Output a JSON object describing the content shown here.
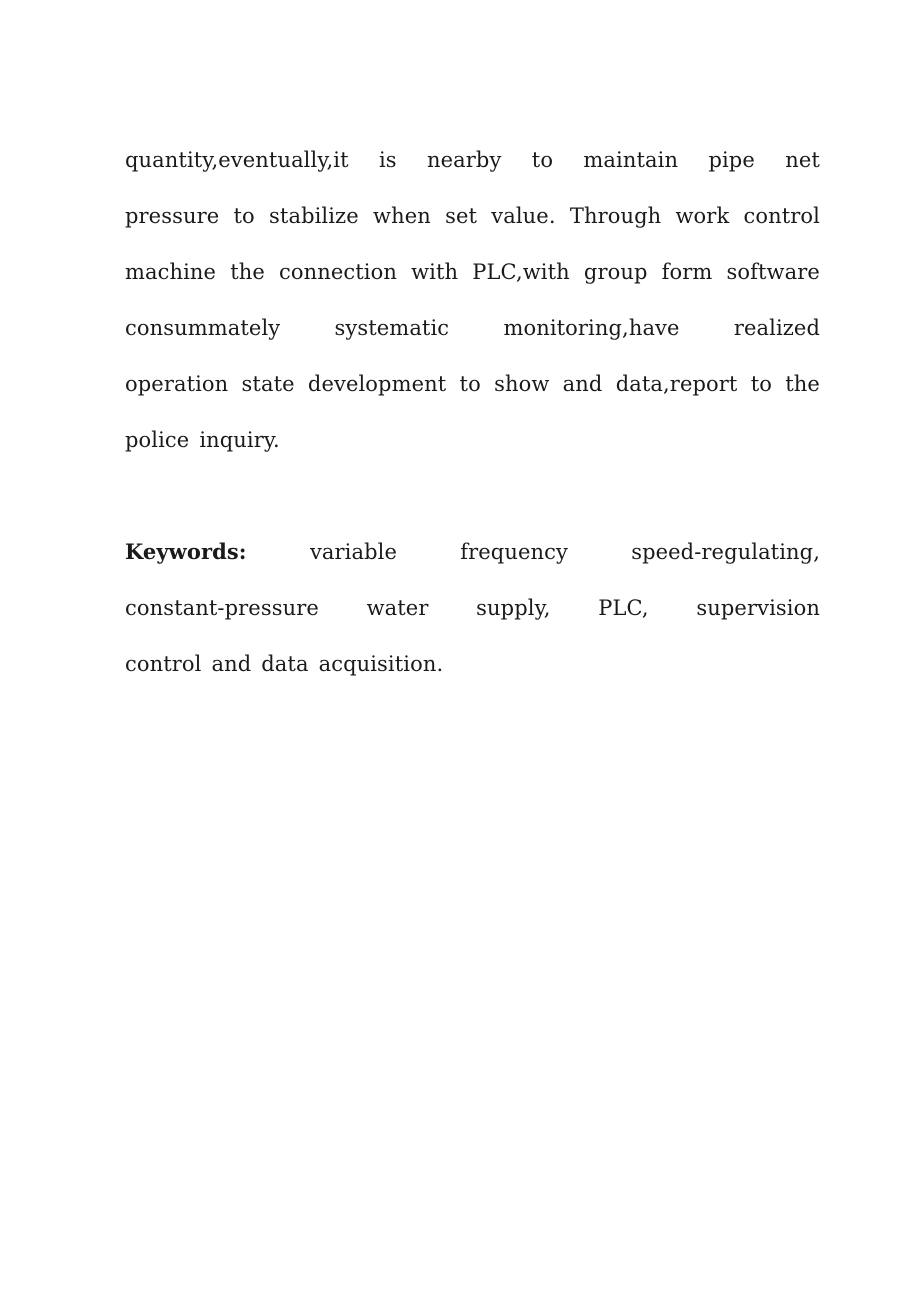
{
  "document": {
    "page_background": "#ffffff",
    "text_color": "#1a1a1a",
    "body": {
      "paragraph_1": {
        "name": "abstract-continuation",
        "full_text": "quantity,eventually,it is nearby to maintain pipe net pressure to stabilize when set value. Through work control machine the connection with PLC,with group form software consummately systematic monitoring,have realized operation state development to show and data,report to the police inquiry.",
        "lines": [
          {
            "justified": true,
            "words": [
              "quantity,eventually,it",
              "is",
              "nearby",
              "to",
              "maintain",
              "pipe",
              "net"
            ]
          },
          {
            "justified": true,
            "words": [
              "pressure",
              "to",
              "stabilize",
              "when",
              "set",
              "value.",
              "Through",
              "work",
              "control"
            ]
          },
          {
            "justified": true,
            "words": [
              "machine",
              "the",
              "connection",
              "with",
              "PLC,with",
              "group",
              "form",
              "software"
            ]
          },
          {
            "justified": true,
            "words": [
              "consummately",
              "systematic",
              "monitoring,have",
              "realized"
            ]
          },
          {
            "justified": true,
            "words": [
              "operation",
              "state",
              "development",
              "to",
              "show",
              "and",
              "data,report",
              "to",
              "the"
            ]
          },
          {
            "justified": false,
            "words": [
              "police",
              "inquiry."
            ]
          }
        ]
      },
      "paragraph_2": {
        "name": "keywords-paragraph",
        "label": "Keywords:",
        "full_text": "Keywords: variable frequency speed-regulating, constant-pressure water supply, PLC, supervision control and data acquisition.",
        "keyword_list": [
          "variable frequency speed-regulating",
          "constant-pressure water supply",
          "PLC",
          "supervision control and data acquisition"
        ],
        "lines": [
          {
            "justified": true,
            "words": [
              "Keywords:",
              "variable",
              "frequency",
              "speed-regulating,"
            ],
            "bold_indices": [
              0
            ]
          },
          {
            "justified": true,
            "words": [
              "constant-pressure",
              "water",
              "supply,",
              "PLC,",
              "supervision"
            ],
            "bold_indices": []
          },
          {
            "justified": false,
            "words": [
              "control",
              "and",
              "data",
              "acquisition."
            ],
            "bold_indices": []
          }
        ]
      }
    }
  }
}
